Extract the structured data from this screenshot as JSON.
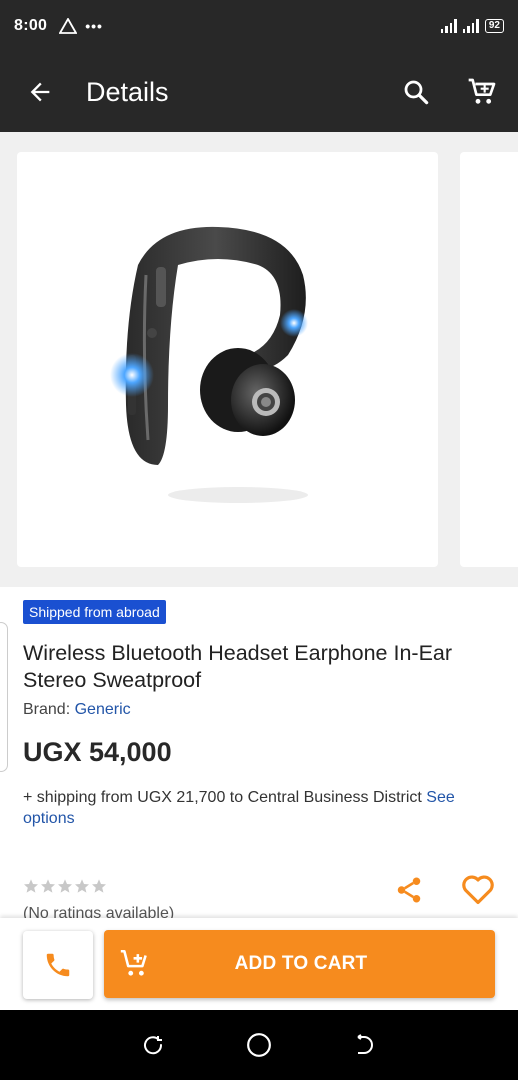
{
  "status_bar": {
    "time": "8:00",
    "dots": "•••",
    "battery": "92"
  },
  "app_bar": {
    "title": "Details"
  },
  "product": {
    "badge": "Shipped from abroad",
    "title": "Wireless Bluetooth Headset Earphone In-Ear Stereo Sweatproof",
    "brand_label": "Brand: ",
    "brand_value": "Generic",
    "price": "UGX 54,000",
    "shipping_text": "+ shipping from UGX 21,700 to Central Business District ",
    "shipping_link": "See options",
    "rating_stars": 0,
    "rating_text": "(No ratings available)"
  },
  "actions": {
    "add_to_cart_label": "ADD TO CART"
  },
  "colors": {
    "accent": "#f68b1e",
    "badge": "#1a50d1",
    "link": "#2255a8",
    "header": "#282828"
  },
  "icons": [
    "back-arrow-icon",
    "search-icon",
    "cart-icon",
    "share-icon",
    "heart-icon",
    "phone-icon",
    "add-cart-icon",
    "recent-apps-icon",
    "home-icon",
    "back-icon"
  ]
}
